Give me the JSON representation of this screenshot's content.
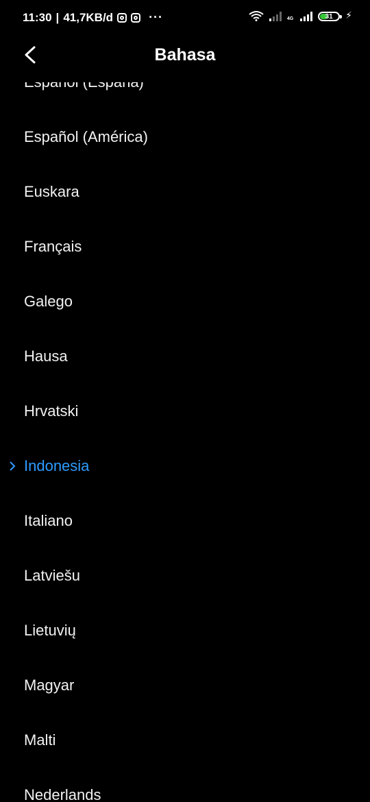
{
  "status_bar": {
    "time": "11:30",
    "speed": "41,7KB/d",
    "more": "···",
    "network": "4G",
    "battery": "31"
  },
  "header": {
    "title": "Bahasa"
  },
  "languages": [
    "Español (España)",
    "Español (América)",
    "Euskara",
    "Français",
    "Galego",
    "Hausa",
    "Hrvatski",
    "Indonesia",
    "Italiano",
    "Latviešu",
    "Lietuvių",
    "Magyar",
    "Malti",
    "Nederlands"
  ],
  "selected_language": "Indonesia",
  "colors": {
    "accent": "#2e9bff",
    "background": "#000000",
    "text": "#f2f2f2"
  }
}
